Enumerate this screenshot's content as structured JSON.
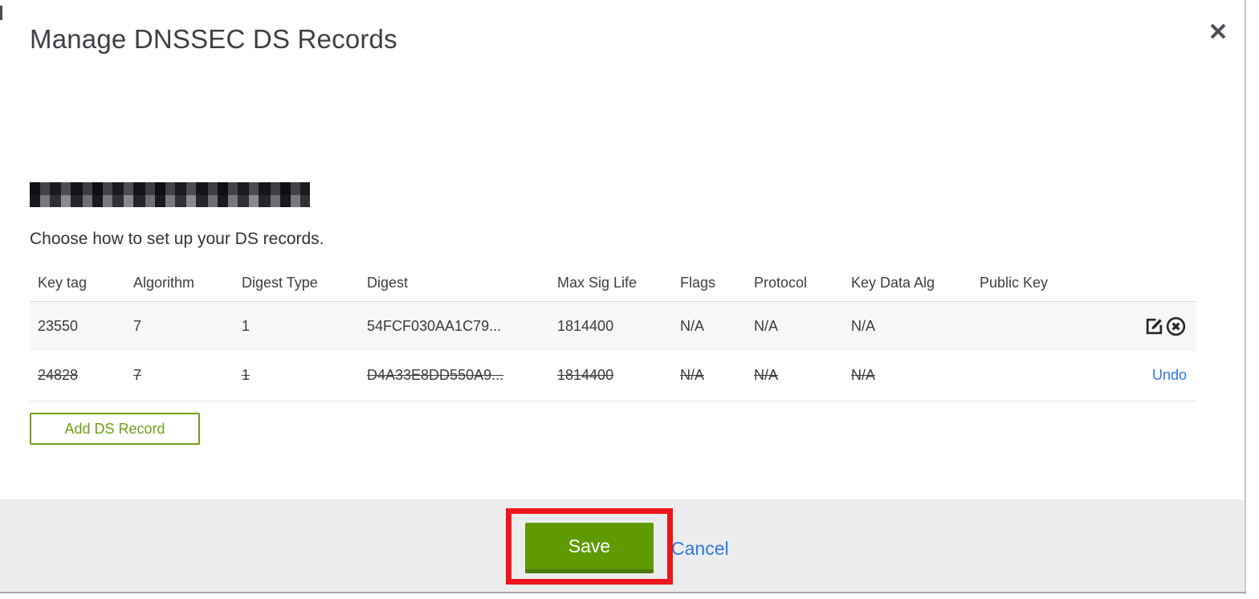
{
  "dialog": {
    "title": "Manage DNSSEC DS Records",
    "instruction": "Choose how to set up your DS records.",
    "domain": {
      "redacted": true
    }
  },
  "table": {
    "columns": [
      "Key tag",
      "Algorithm",
      "Digest Type",
      "Digest",
      "Max Sig Life",
      "Flags",
      "Protocol",
      "Key Data Alg",
      "Public Key"
    ],
    "rows": [
      {
        "key_tag": "23550",
        "algorithm": "7",
        "digest_type": "1",
        "digest": "54FCF030AA1C79...",
        "max_sig_life": "1814400",
        "flags": "N/A",
        "protocol": "N/A",
        "key_data_alg": "N/A",
        "public_key": "",
        "state": "normal"
      },
      {
        "key_tag": "24828",
        "algorithm": "7",
        "digest_type": "1",
        "digest": "D4A33E8DD550A9...",
        "max_sig_life": "1814400",
        "flags": "N/A",
        "protocol": "N/A",
        "key_data_alg": "N/A",
        "public_key": "",
        "state": "deleted",
        "undo_label": "Undo"
      }
    ]
  },
  "buttons": {
    "add_ds_record": "Add DS Record",
    "save": "Save",
    "cancel": "Cancel"
  },
  "icons": {
    "close": "x-close",
    "edit": "edit-pencil-square",
    "delete": "circle-x"
  },
  "annotation": {
    "type": "red-box-highlight",
    "target": "save-button"
  },
  "colors": {
    "button_green": "#609a03",
    "button_green_dark": "#4b7a02",
    "outline_green": "#6da014",
    "link_blue": "#2e79e8",
    "annotation_red": "#ee161b",
    "footer_gray": "#ececec",
    "row_gray": "#f7f7f7"
  }
}
